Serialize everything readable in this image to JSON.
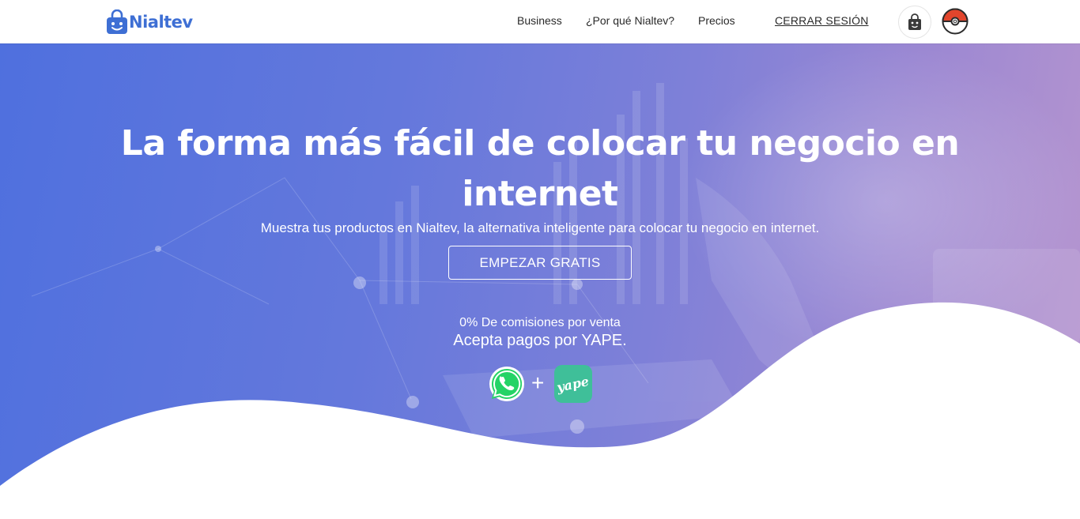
{
  "brand": {
    "name": "Nialtev",
    "color": "#3e6fd4"
  },
  "nav": {
    "business": "Business",
    "why": "¿Por qué Nialtev?",
    "prices": "Precios",
    "logout": "CERRAR SESIÓN"
  },
  "header_icons": {
    "shop": "shop-avatar-icon",
    "user": "pokeball-avatar-icon"
  },
  "hero": {
    "headline": "La forma más fácil de colocar tu negocio en internet",
    "subline": "Muestra tus productos en Nialtev, la alternativa inteligente para colocar tu negocio en internet.",
    "cta": "EMPEZAR GRATIS",
    "commission": "0% De comisiones por venta",
    "payments": "Acepta pagos por YAPE.",
    "plus": "+",
    "yape_logo_text": "yape",
    "gradient": [
      "#4f70de",
      "#b896cf"
    ]
  },
  "colors": {
    "whatsapp": "#25d366",
    "yape": "#3fbf99"
  }
}
